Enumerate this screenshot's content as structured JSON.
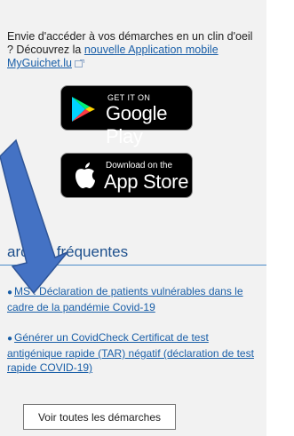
{
  "intro": {
    "text_before": "Envie d'accéder à vos démarches en un clin d'oeil ? Découvrez la ",
    "link_text": "nouvelle Application mobile MyGuichet.lu"
  },
  "badges": {
    "google_play": {
      "small": "GET IT ON",
      "big": "Google Play"
    },
    "app_store": {
      "small": "Download on the",
      "big": "App Store"
    }
  },
  "section": {
    "title": "arches fréquentes",
    "items": [
      {
        "label": "MS : Déclaration de patients vulnérables dans le cadre de la pandémie Covid-19"
      },
      {
        "label": "Générer un CovidCheck Certificat de test antigénique rapide (TAR) négatif (déclaration de test rapide COVID-19)"
      }
    ],
    "button_label": "Voir toutes les démarches"
  },
  "colors": {
    "link": "#1a5fa8",
    "arrow": "#4472c4",
    "title": "#1d4f8c"
  },
  "icons": [
    "external-link-icon",
    "google-play-icon",
    "apple-icon",
    "bullet-icon"
  ]
}
